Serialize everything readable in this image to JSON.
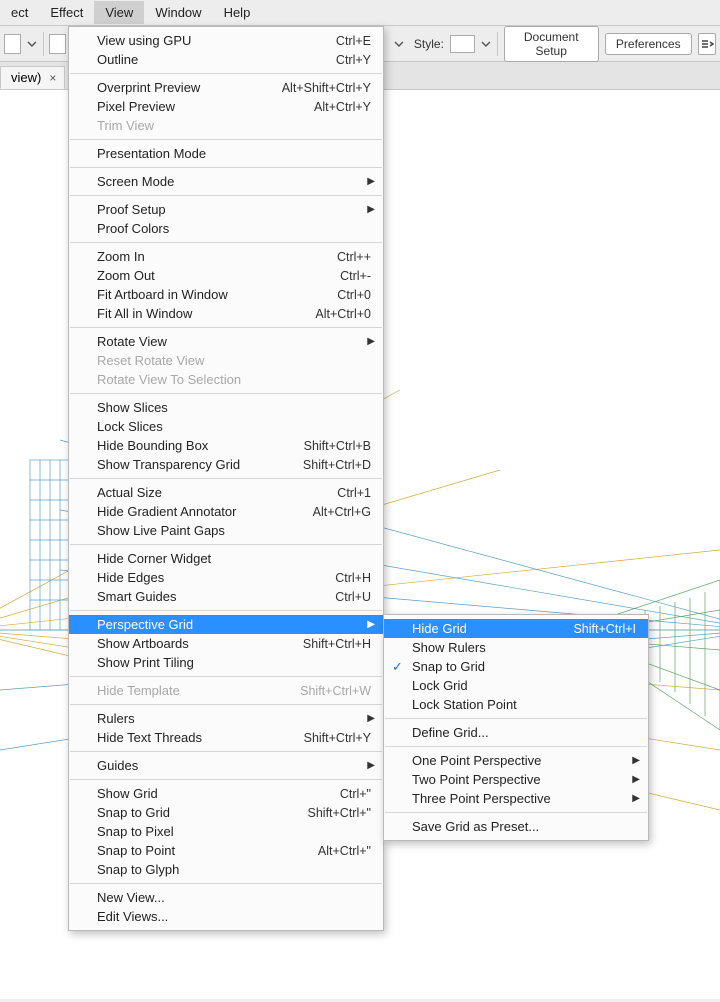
{
  "menubar": {
    "items": [
      "ect",
      "Effect",
      "View",
      "Window",
      "Help"
    ],
    "active": 2
  },
  "optbar": {
    "style_label": "Style:",
    "doc_setup": "Document Setup",
    "prefs": "Preferences"
  },
  "tab": {
    "title": "view)",
    "close": "×"
  },
  "view_menu": [
    {
      "t": "item",
      "label": "View using GPU",
      "accel": "Ctrl+E"
    },
    {
      "t": "item",
      "label": "Outline",
      "accel": "Ctrl+Y"
    },
    {
      "t": "sep"
    },
    {
      "t": "item",
      "label": "Overprint Preview",
      "accel": "Alt+Shift+Ctrl+Y"
    },
    {
      "t": "item",
      "label": "Pixel Preview",
      "accel": "Alt+Ctrl+Y"
    },
    {
      "t": "item",
      "label": "Trim View",
      "disabled": true
    },
    {
      "t": "sep"
    },
    {
      "t": "item",
      "label": "Presentation Mode"
    },
    {
      "t": "sep"
    },
    {
      "t": "item",
      "label": "Screen Mode",
      "sub": true
    },
    {
      "t": "sep"
    },
    {
      "t": "item",
      "label": "Proof Setup",
      "sub": true
    },
    {
      "t": "item",
      "label": "Proof Colors"
    },
    {
      "t": "sep"
    },
    {
      "t": "item",
      "label": "Zoom In",
      "accel": "Ctrl++"
    },
    {
      "t": "item",
      "label": "Zoom Out",
      "accel": "Ctrl+-"
    },
    {
      "t": "item",
      "label": "Fit Artboard in Window",
      "accel": "Ctrl+0"
    },
    {
      "t": "item",
      "label": "Fit All in Window",
      "accel": "Alt+Ctrl+0"
    },
    {
      "t": "sep"
    },
    {
      "t": "item",
      "label": "Rotate View",
      "sub": true
    },
    {
      "t": "item",
      "label": "Reset Rotate View",
      "disabled": true
    },
    {
      "t": "item",
      "label": "Rotate View To Selection",
      "disabled": true
    },
    {
      "t": "sep"
    },
    {
      "t": "item",
      "label": "Show Slices"
    },
    {
      "t": "item",
      "label": "Lock Slices"
    },
    {
      "t": "item",
      "label": "Hide Bounding Box",
      "accel": "Shift+Ctrl+B"
    },
    {
      "t": "item",
      "label": "Show Transparency Grid",
      "accel": "Shift+Ctrl+D"
    },
    {
      "t": "sep"
    },
    {
      "t": "item",
      "label": "Actual Size",
      "accel": "Ctrl+1"
    },
    {
      "t": "item",
      "label": "Hide Gradient Annotator",
      "accel": "Alt+Ctrl+G"
    },
    {
      "t": "item",
      "label": "Show Live Paint Gaps"
    },
    {
      "t": "sep"
    },
    {
      "t": "item",
      "label": "Hide Corner Widget"
    },
    {
      "t": "item",
      "label": "Hide Edges",
      "accel": "Ctrl+H"
    },
    {
      "t": "item",
      "label": "Smart Guides",
      "accel": "Ctrl+U"
    },
    {
      "t": "sep"
    },
    {
      "t": "item",
      "label": "Perspective Grid",
      "sub": true,
      "hl": true
    },
    {
      "t": "item",
      "label": "Show Artboards",
      "accel": "Shift+Ctrl+H"
    },
    {
      "t": "item",
      "label": "Show Print Tiling"
    },
    {
      "t": "sep"
    },
    {
      "t": "item",
      "label": "Hide Template",
      "accel": "Shift+Ctrl+W",
      "disabled": true
    },
    {
      "t": "sep"
    },
    {
      "t": "item",
      "label": "Rulers",
      "sub": true
    },
    {
      "t": "item",
      "label": "Hide Text Threads",
      "accel": "Shift+Ctrl+Y"
    },
    {
      "t": "sep"
    },
    {
      "t": "item",
      "label": "Guides",
      "sub": true
    },
    {
      "t": "sep"
    },
    {
      "t": "item",
      "label": "Show Grid",
      "accel": "Ctrl+\""
    },
    {
      "t": "item",
      "label": "Snap to Grid",
      "accel": "Shift+Ctrl+\""
    },
    {
      "t": "item",
      "label": "Snap to Pixel"
    },
    {
      "t": "item",
      "label": "Snap to Point",
      "accel": "Alt+Ctrl+\""
    },
    {
      "t": "item",
      "label": "Snap to Glyph"
    },
    {
      "t": "sep"
    },
    {
      "t": "item",
      "label": "New View..."
    },
    {
      "t": "item",
      "label": "Edit Views..."
    }
  ],
  "sub_menu": [
    {
      "t": "item",
      "label": "Hide Grid",
      "accel": "Shift+Ctrl+I",
      "hl": true
    },
    {
      "t": "item",
      "label": "Show Rulers"
    },
    {
      "t": "item",
      "label": "Snap to Grid",
      "checked": true
    },
    {
      "t": "item",
      "label": "Lock Grid"
    },
    {
      "t": "item",
      "label": "Lock Station Point"
    },
    {
      "t": "sep"
    },
    {
      "t": "item",
      "label": "Define Grid..."
    },
    {
      "t": "sep"
    },
    {
      "t": "item",
      "label": "One Point Perspective",
      "sub": true
    },
    {
      "t": "item",
      "label": "Two Point Perspective",
      "sub": true
    },
    {
      "t": "item",
      "label": "Three Point Perspective",
      "sub": true
    },
    {
      "t": "sep"
    },
    {
      "t": "item",
      "label": "Save Grid as Preset..."
    }
  ]
}
